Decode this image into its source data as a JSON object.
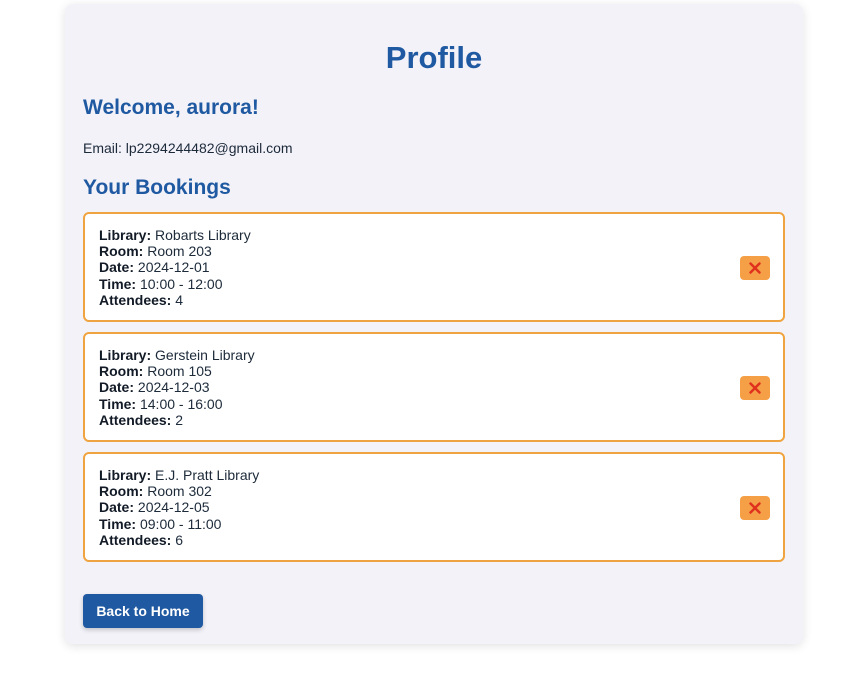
{
  "profile": {
    "title": "Profile",
    "welcome": "Welcome, aurora!",
    "email_line": "Email: lp2294244482@gmail.com",
    "bookings_title": "Your Bookings"
  },
  "labels": {
    "library": "Library:",
    "room": "Room:",
    "date": "Date:",
    "time": "Time:",
    "attendees": "Attendees:"
  },
  "bookings": [
    {
      "library": "Robarts Library",
      "room": "Room 203",
      "date": "2024-12-01",
      "time": "10:00 - 12:00",
      "attendees": "4"
    },
    {
      "library": "Gerstein Library",
      "room": "Room 105",
      "date": "2024-12-03",
      "time": "14:00 - 16:00",
      "attendees": "2"
    },
    {
      "library": "E.J. Pratt Library",
      "room": "Room 302",
      "date": "2024-12-05",
      "time": "09:00 - 11:00",
      "attendees": "6"
    }
  ],
  "actions": {
    "cancel_icon": "close-icon",
    "back_label": "Back to Home"
  },
  "colors": {
    "accent": "#1f59a1",
    "card_border": "#f0a441",
    "cancel_bg": "#f5a047",
    "cancel_x": "#e0301e",
    "panel_bg": "#f3f2f9"
  }
}
